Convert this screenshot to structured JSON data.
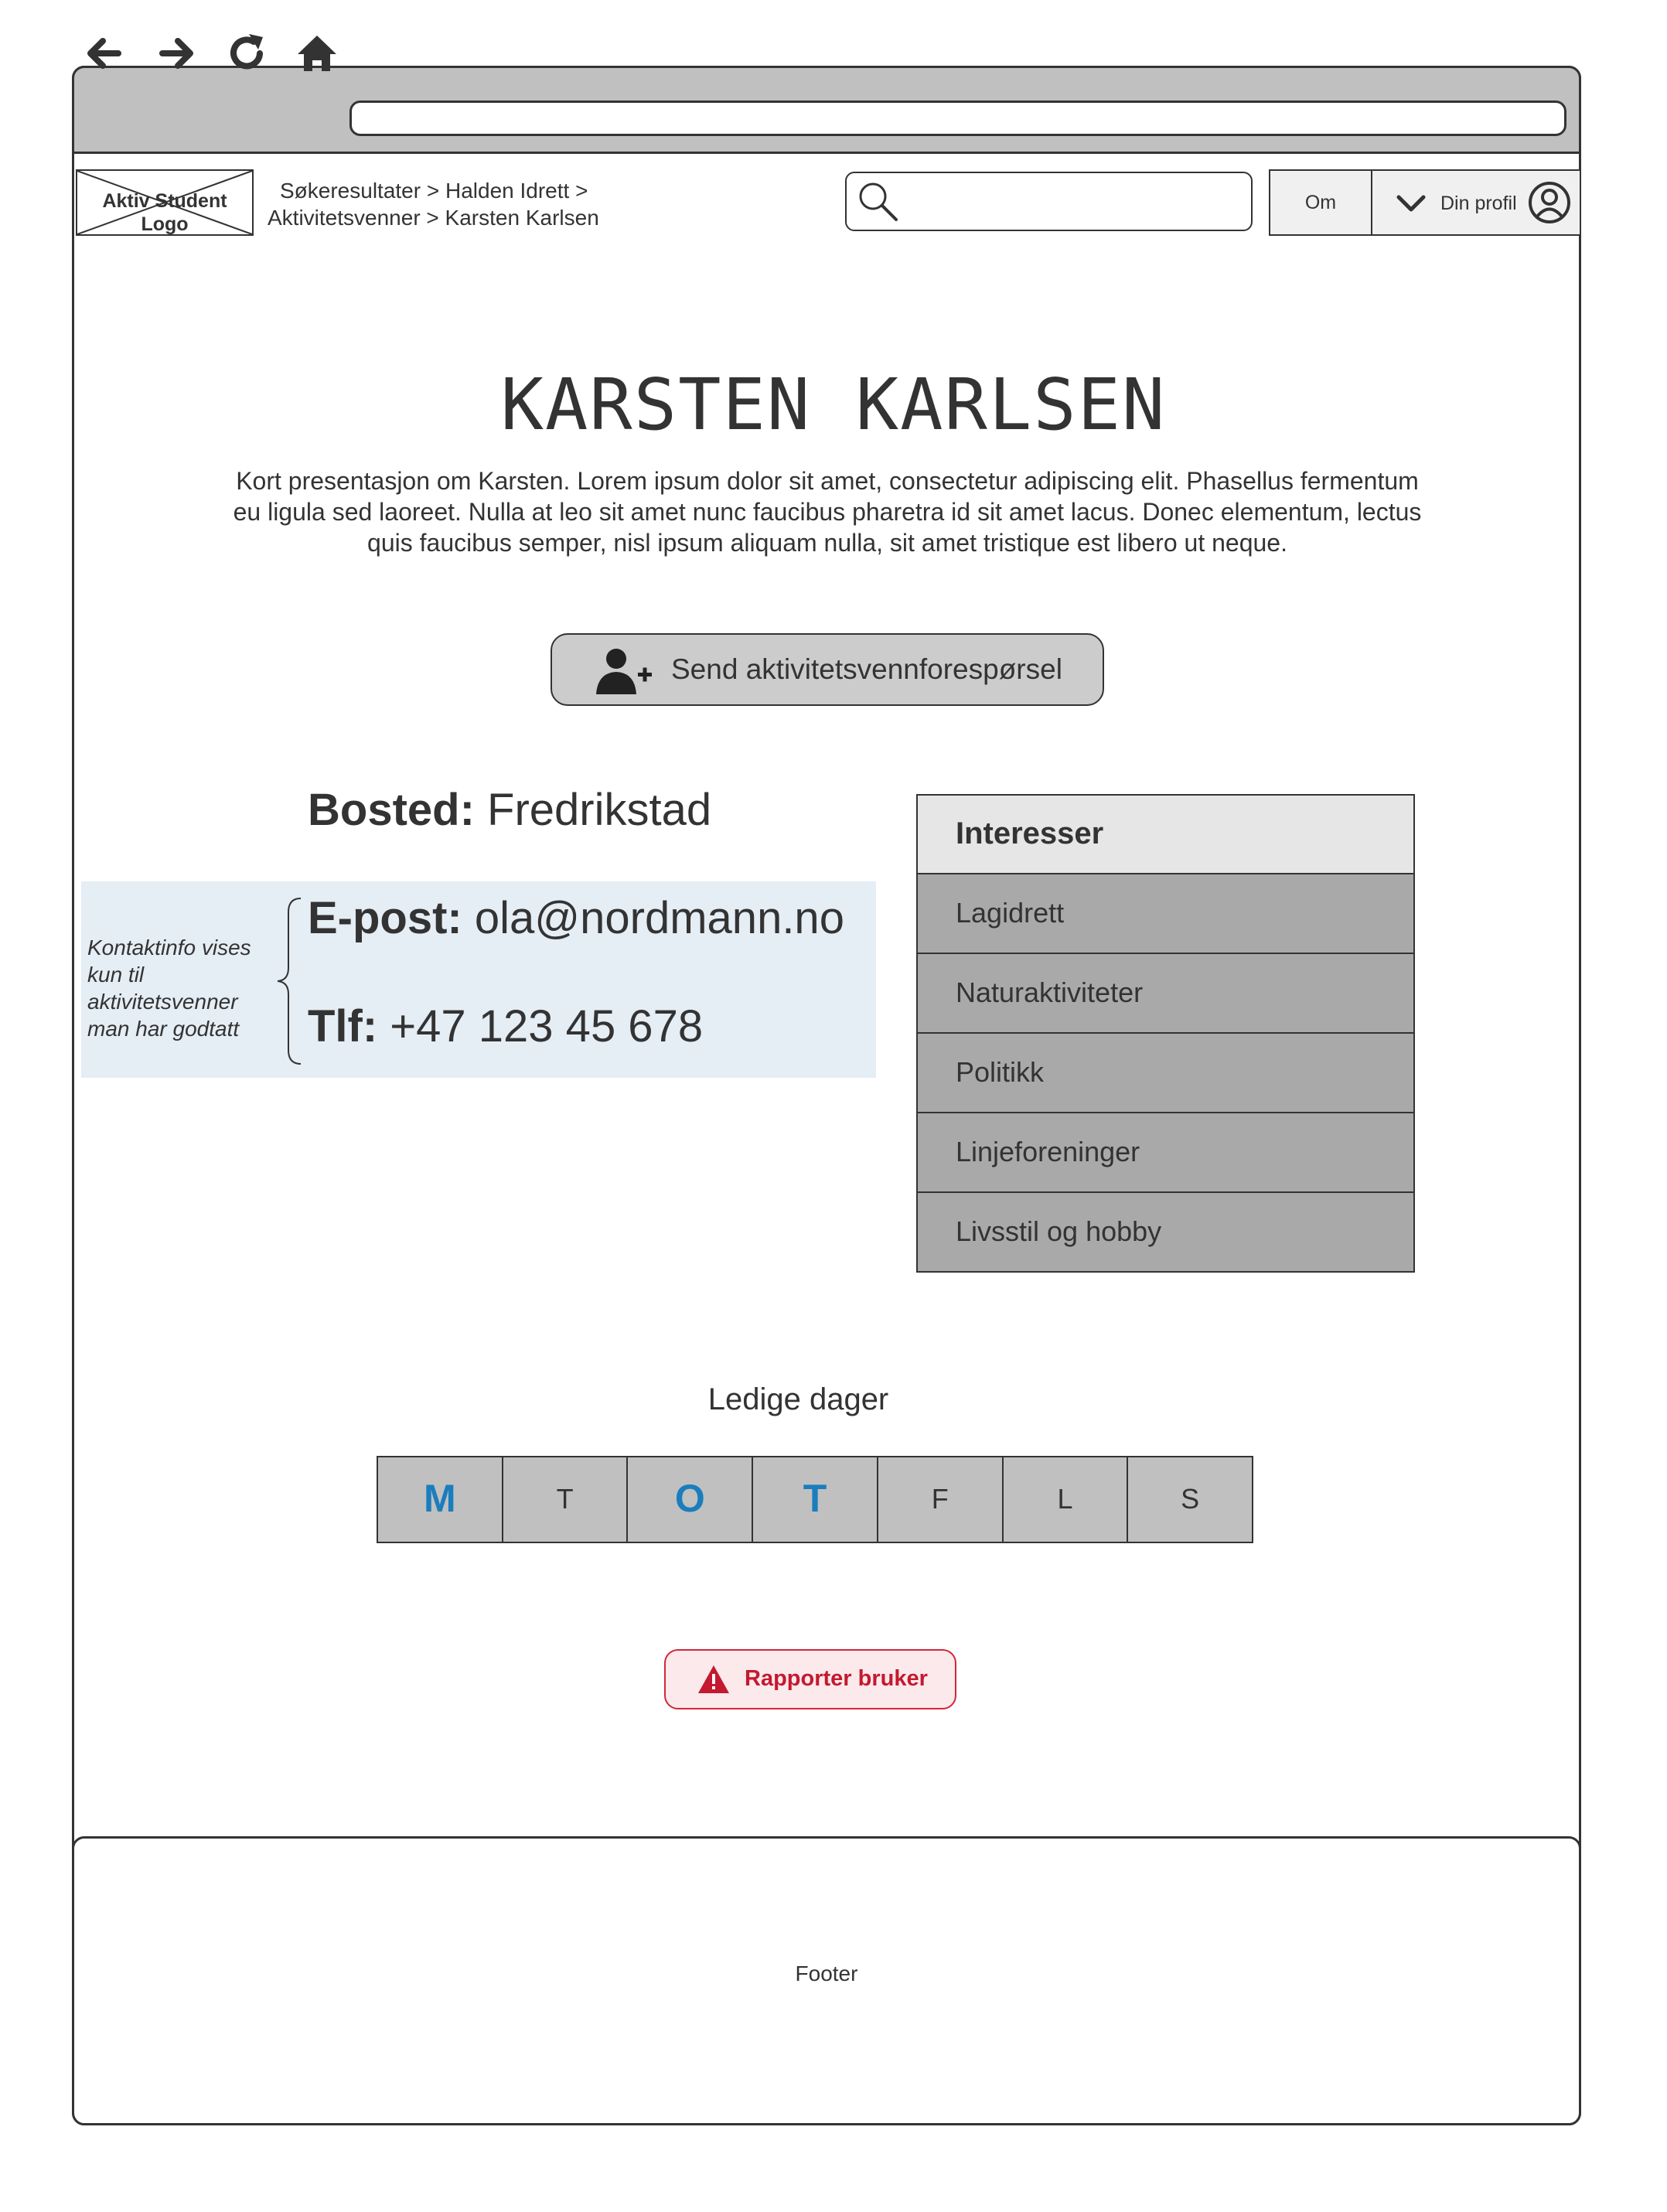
{
  "browser": {
    "back_icon": "arrow-left-icon",
    "forward_icon": "arrow-right-icon",
    "reload_icon": "reload-icon",
    "home_icon": "home-icon",
    "url": ""
  },
  "header": {
    "logo_text": "Aktiv Student Logo",
    "breadcrumb_line1": "Søkeresultater  >  Halden Idrett  >",
    "breadcrumb_line2": "Aktivitetsvenner  >   Karsten Karlsen",
    "search_placeholder": "",
    "nav_om": "Om",
    "nav_profile": "Din profil"
  },
  "profile": {
    "name": "KARSTEN KARLSEN",
    "intro": "Kort presentasjon om Karsten. Lorem ipsum dolor sit amet, consectetur adipiscing elit. Phasellus fermentum eu ligula sed laoreet. Nulla at leo sit amet nunc faucibus pharetra id sit amet lacus. Donec elementum, lectus quis faucibus semper, nisl ipsum aliquam nulla, sit amet tristique est libero ut neque.",
    "friend_request_button": "Send aktivitetsvennforespørsel",
    "bosted_label": "Bosted:",
    "bosted_value": "Fredrikstad",
    "contact_note": "Kontaktinfo vises kun til aktivitetsvenner man har godtatt",
    "email_label": "E-post:",
    "email_value": "ola@nordmann.no",
    "tlf_label": "Tlf:",
    "tlf_value": "+47 123 45 678"
  },
  "interests": {
    "header": "Interesser",
    "items": [
      "Lagidrett",
      "Naturaktiviteter",
      "Politikk",
      "Linjeforeninger",
      "Livsstil og hobby"
    ]
  },
  "availability": {
    "title": "Ledige dager",
    "days": [
      {
        "label": "M",
        "active": true
      },
      {
        "label": "T",
        "active": false
      },
      {
        "label": "O",
        "active": true
      },
      {
        "label": "T",
        "active": true
      },
      {
        "label": "F",
        "active": false
      },
      {
        "label": "L",
        "active": false
      },
      {
        "label": "S",
        "active": false
      }
    ],
    "active_color": "#1a7dbd"
  },
  "report": {
    "label": "Rapporter bruker",
    "color": "#c4192f"
  },
  "footer": {
    "label": "Footer"
  }
}
